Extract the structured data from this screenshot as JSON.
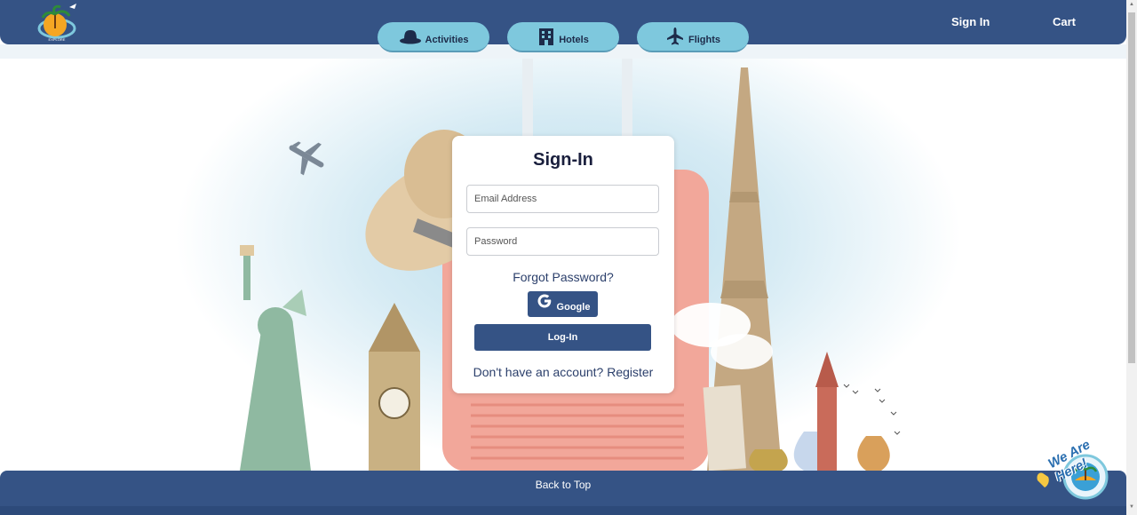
{
  "header": {
    "logo_icon": "palm-island-plane-logo",
    "nav": {
      "signin_label": "Sign In",
      "cart_label": "Cart"
    },
    "tabs": [
      {
        "label": "Activities",
        "icon": "hat-icon"
      },
      {
        "label": "Hotels",
        "icon": "building-icon"
      },
      {
        "label": "Flights",
        "icon": "plane-icon"
      }
    ]
  },
  "signin": {
    "title": "Sign-In",
    "email_placeholder": "Email Address",
    "password_placeholder": "Password",
    "forgot_label": "Forgot Password?",
    "google_label": "Google",
    "login_label": "Log-In",
    "register_label": "Don't have an account? Register"
  },
  "footer": {
    "back_to_top_label": "Back to Top"
  },
  "chat_widget": {
    "label": "We Are Here!"
  },
  "colors": {
    "primary": "#355385",
    "tab": "#7ec8dd",
    "accent_text": "#2b3f6b"
  }
}
